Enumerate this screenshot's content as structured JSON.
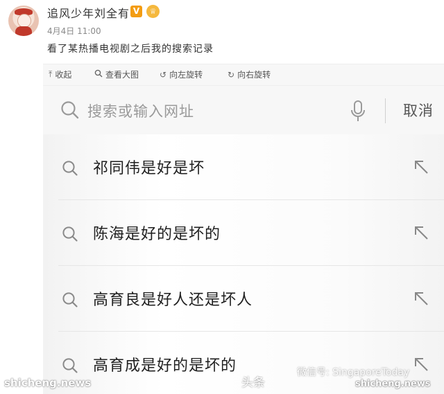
{
  "post": {
    "username": "追风少年刘全有",
    "v_badge": "V",
    "time": "4月4日 11:00",
    "text": "看了某热播电视剧之后我的搜索记录"
  },
  "toolbar": {
    "collapse": "收起",
    "view_large": "查看大图",
    "rotate_left": "向左旋转",
    "rotate_right": "向右旋转"
  },
  "search": {
    "placeholder": "搜索或输入网址",
    "cancel": "取消"
  },
  "history": [
    {
      "text": "祁同伟是好是坏"
    },
    {
      "text": "陈海是好的是坏的"
    },
    {
      "text": "高育良是好人还是坏人"
    },
    {
      "text": "高育成是好的是坏的"
    }
  ],
  "watermarks": {
    "left": "shicheng.news",
    "toutiao": "头条",
    "weixin": "微信号: SingaporeToday",
    "right": "shicheng.news"
  },
  "colors": {
    "vip_badge": "#f39c12",
    "text_dark": "#1f1f1f",
    "placeholder": "#9a9a9a",
    "time_gray": "#8a8a8a"
  }
}
